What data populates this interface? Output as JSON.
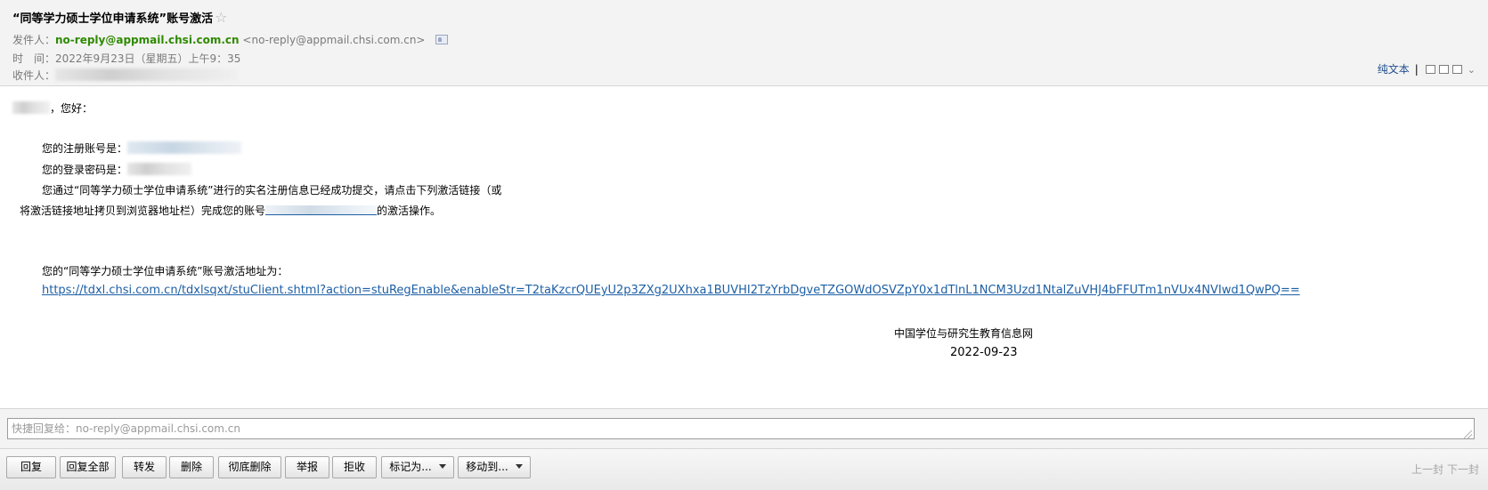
{
  "header": {
    "subject": "“同等学力硕士学位申请系统”账号激活",
    "star_glyph": "☆",
    "from_label": "发件人：",
    "from_name": "no-reply@appmail.chsi.com.cn",
    "from_addr": "<no-reply@appmail.chsi.com.cn>",
    "time_label": "时　间：",
    "time_value": "2022年9月23日（星期五）上午9：35",
    "to_label": "收件人：",
    "plain_text": "纯文本",
    "separator": "|"
  },
  "body": {
    "greeting_suffix": "，您好：",
    "account_label": "您的注册账号是：",
    "password_label": "您的登录密码是：",
    "para1": "您通过“同等学力硕士学位申请系统”进行的实名注册信息已经成功提交，请点击下列激活链接（或",
    "para2_prefix": "将激活链接地址拷贝到浏览器地址栏）完成您的账号",
    "para2_suffix": "的激活操作。",
    "addr_label": "您的“同等学力硕士学位申请系统”账号激活地址为：",
    "activation_link": "https://tdxl.chsi.com.cn/tdxlsqxt/stuClient.shtml?action=stuRegEnable&enableStr=T2taKzcrQUEyU2p3ZXg2UXhxa1BUVHI2TzYrbDgveTZGOWdOSVZpY0x1dTlnL1NCM3Uzd1NtalZuVHJ4bFFUTm1nVUx4NVIwd1QwPQ==",
    "signature_org": "中国学位与研究生教育信息网",
    "signature_date": "2022-09-23"
  },
  "quick_reply": {
    "placeholder": "快捷回复给：no-reply@appmail.chsi.com.cn"
  },
  "toolbar": {
    "reply": "回复",
    "reply_all": "回复全部",
    "forward": "转发",
    "delete": "删除",
    "perm_delete": "彻底删除",
    "report": "举报",
    "reject": "拒收",
    "mark_as": "标记为...",
    "move_to": "移动到...",
    "prev": "上一封",
    "next": "下一封"
  },
  "colors": {
    "header_bg": "#f3f3f3",
    "sender_green": "#2f8a00",
    "link_blue": "#1d5fa5"
  }
}
